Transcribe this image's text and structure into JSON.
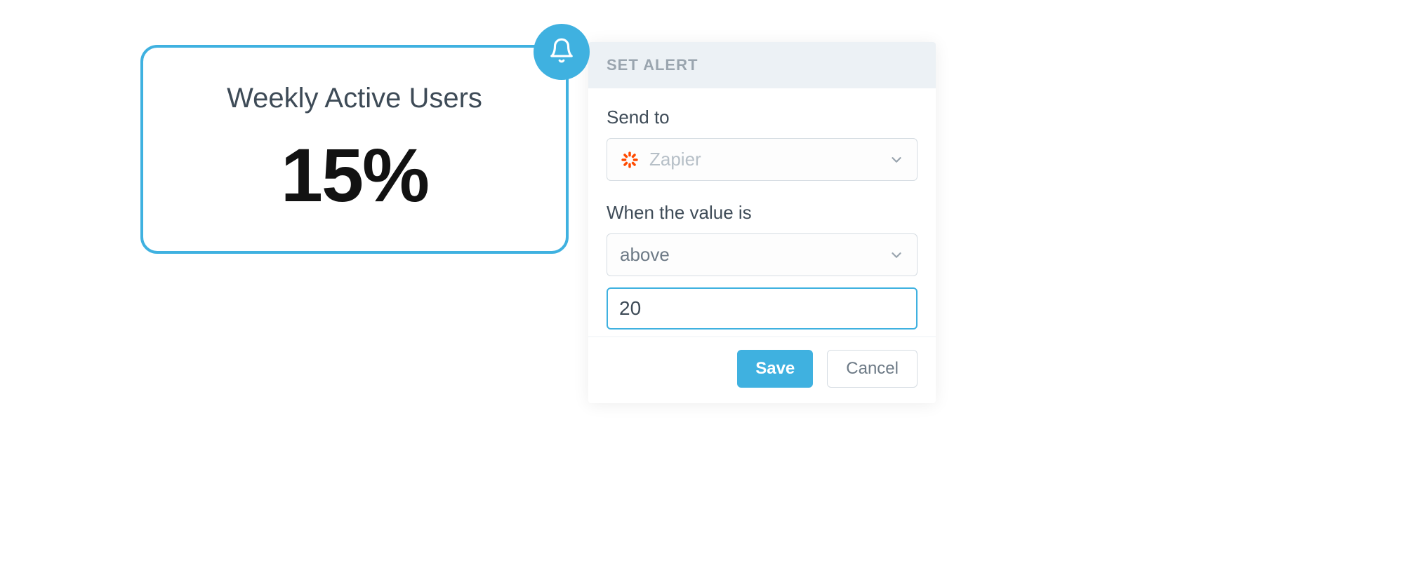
{
  "metric": {
    "title": "Weekly Active Users",
    "value": "15%"
  },
  "alert_panel": {
    "header": "SET ALERT",
    "send_to": {
      "label": "Send to",
      "selected": "Zapier"
    },
    "condition": {
      "label": "When the value is",
      "operator": "above",
      "value": "20"
    },
    "buttons": {
      "save": "Save",
      "cancel": "Cancel"
    }
  },
  "colors": {
    "accent": "#3fb1e0",
    "zapier": "#ff4a00"
  }
}
